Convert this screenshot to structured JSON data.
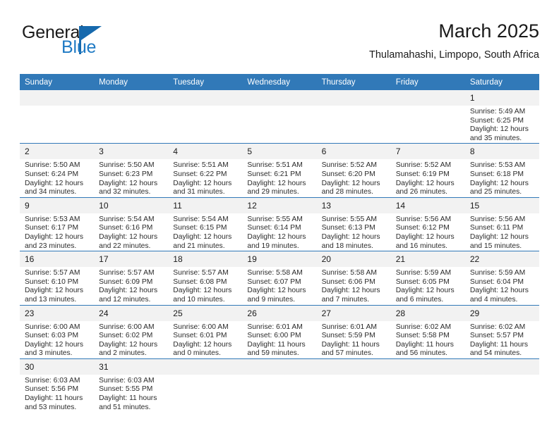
{
  "brand": {
    "name_top": "General",
    "name_bottom": "Blue",
    "accent_color": "#1f7ac4",
    "flag_color": "#1669ad"
  },
  "header": {
    "title": "March 2025",
    "subtitle": "Thulamahashi, Limpopo, South Africa",
    "header_bg_color": "#3179b8",
    "daynum_bg_color": "#f2f2f2"
  },
  "weekdays": [
    "Sunday",
    "Monday",
    "Tuesday",
    "Wednesday",
    "Thursday",
    "Friday",
    "Saturday"
  ],
  "weeks": [
    [
      {
        "day": "",
        "sunrise": "",
        "sunset": "",
        "daylight_1": "",
        "daylight_2": ""
      },
      {
        "day": "",
        "sunrise": "",
        "sunset": "",
        "daylight_1": "",
        "daylight_2": ""
      },
      {
        "day": "",
        "sunrise": "",
        "sunset": "",
        "daylight_1": "",
        "daylight_2": ""
      },
      {
        "day": "",
        "sunrise": "",
        "sunset": "",
        "daylight_1": "",
        "daylight_2": ""
      },
      {
        "day": "",
        "sunrise": "",
        "sunset": "",
        "daylight_1": "",
        "daylight_2": ""
      },
      {
        "day": "",
        "sunrise": "",
        "sunset": "",
        "daylight_1": "",
        "daylight_2": ""
      },
      {
        "day": "1",
        "sunrise": "Sunrise: 5:49 AM",
        "sunset": "Sunset: 6:25 PM",
        "daylight_1": "Daylight: 12 hours",
        "daylight_2": "and 35 minutes."
      }
    ],
    [
      {
        "day": "2",
        "sunrise": "Sunrise: 5:50 AM",
        "sunset": "Sunset: 6:24 PM",
        "daylight_1": "Daylight: 12 hours",
        "daylight_2": "and 34 minutes."
      },
      {
        "day": "3",
        "sunrise": "Sunrise: 5:50 AM",
        "sunset": "Sunset: 6:23 PM",
        "daylight_1": "Daylight: 12 hours",
        "daylight_2": "and 32 minutes."
      },
      {
        "day": "4",
        "sunrise": "Sunrise: 5:51 AM",
        "sunset": "Sunset: 6:22 PM",
        "daylight_1": "Daylight: 12 hours",
        "daylight_2": "and 31 minutes."
      },
      {
        "day": "5",
        "sunrise": "Sunrise: 5:51 AM",
        "sunset": "Sunset: 6:21 PM",
        "daylight_1": "Daylight: 12 hours",
        "daylight_2": "and 29 minutes."
      },
      {
        "day": "6",
        "sunrise": "Sunrise: 5:52 AM",
        "sunset": "Sunset: 6:20 PM",
        "daylight_1": "Daylight: 12 hours",
        "daylight_2": "and 28 minutes."
      },
      {
        "day": "7",
        "sunrise": "Sunrise: 5:52 AM",
        "sunset": "Sunset: 6:19 PM",
        "daylight_1": "Daylight: 12 hours",
        "daylight_2": "and 26 minutes."
      },
      {
        "day": "8",
        "sunrise": "Sunrise: 5:53 AM",
        "sunset": "Sunset: 6:18 PM",
        "daylight_1": "Daylight: 12 hours",
        "daylight_2": "and 25 minutes."
      }
    ],
    [
      {
        "day": "9",
        "sunrise": "Sunrise: 5:53 AM",
        "sunset": "Sunset: 6:17 PM",
        "daylight_1": "Daylight: 12 hours",
        "daylight_2": "and 23 minutes."
      },
      {
        "day": "10",
        "sunrise": "Sunrise: 5:54 AM",
        "sunset": "Sunset: 6:16 PM",
        "daylight_1": "Daylight: 12 hours",
        "daylight_2": "and 22 minutes."
      },
      {
        "day": "11",
        "sunrise": "Sunrise: 5:54 AM",
        "sunset": "Sunset: 6:15 PM",
        "daylight_1": "Daylight: 12 hours",
        "daylight_2": "and 21 minutes."
      },
      {
        "day": "12",
        "sunrise": "Sunrise: 5:55 AM",
        "sunset": "Sunset: 6:14 PM",
        "daylight_1": "Daylight: 12 hours",
        "daylight_2": "and 19 minutes."
      },
      {
        "day": "13",
        "sunrise": "Sunrise: 5:55 AM",
        "sunset": "Sunset: 6:13 PM",
        "daylight_1": "Daylight: 12 hours",
        "daylight_2": "and 18 minutes."
      },
      {
        "day": "14",
        "sunrise": "Sunrise: 5:56 AM",
        "sunset": "Sunset: 6:12 PM",
        "daylight_1": "Daylight: 12 hours",
        "daylight_2": "and 16 minutes."
      },
      {
        "day": "15",
        "sunrise": "Sunrise: 5:56 AM",
        "sunset": "Sunset: 6:11 PM",
        "daylight_1": "Daylight: 12 hours",
        "daylight_2": "and 15 minutes."
      }
    ],
    [
      {
        "day": "16",
        "sunrise": "Sunrise: 5:57 AM",
        "sunset": "Sunset: 6:10 PM",
        "daylight_1": "Daylight: 12 hours",
        "daylight_2": "and 13 minutes."
      },
      {
        "day": "17",
        "sunrise": "Sunrise: 5:57 AM",
        "sunset": "Sunset: 6:09 PM",
        "daylight_1": "Daylight: 12 hours",
        "daylight_2": "and 12 minutes."
      },
      {
        "day": "18",
        "sunrise": "Sunrise: 5:57 AM",
        "sunset": "Sunset: 6:08 PM",
        "daylight_1": "Daylight: 12 hours",
        "daylight_2": "and 10 minutes."
      },
      {
        "day": "19",
        "sunrise": "Sunrise: 5:58 AM",
        "sunset": "Sunset: 6:07 PM",
        "daylight_1": "Daylight: 12 hours",
        "daylight_2": "and 9 minutes."
      },
      {
        "day": "20",
        "sunrise": "Sunrise: 5:58 AM",
        "sunset": "Sunset: 6:06 PM",
        "daylight_1": "Daylight: 12 hours",
        "daylight_2": "and 7 minutes."
      },
      {
        "day": "21",
        "sunrise": "Sunrise: 5:59 AM",
        "sunset": "Sunset: 6:05 PM",
        "daylight_1": "Daylight: 12 hours",
        "daylight_2": "and 6 minutes."
      },
      {
        "day": "22",
        "sunrise": "Sunrise: 5:59 AM",
        "sunset": "Sunset: 6:04 PM",
        "daylight_1": "Daylight: 12 hours",
        "daylight_2": "and 4 minutes."
      }
    ],
    [
      {
        "day": "23",
        "sunrise": "Sunrise: 6:00 AM",
        "sunset": "Sunset: 6:03 PM",
        "daylight_1": "Daylight: 12 hours",
        "daylight_2": "and 3 minutes."
      },
      {
        "day": "24",
        "sunrise": "Sunrise: 6:00 AM",
        "sunset": "Sunset: 6:02 PM",
        "daylight_1": "Daylight: 12 hours",
        "daylight_2": "and 2 minutes."
      },
      {
        "day": "25",
        "sunrise": "Sunrise: 6:00 AM",
        "sunset": "Sunset: 6:01 PM",
        "daylight_1": "Daylight: 12 hours",
        "daylight_2": "and 0 minutes."
      },
      {
        "day": "26",
        "sunrise": "Sunrise: 6:01 AM",
        "sunset": "Sunset: 6:00 PM",
        "daylight_1": "Daylight: 11 hours",
        "daylight_2": "and 59 minutes."
      },
      {
        "day": "27",
        "sunrise": "Sunrise: 6:01 AM",
        "sunset": "Sunset: 5:59 PM",
        "daylight_1": "Daylight: 11 hours",
        "daylight_2": "and 57 minutes."
      },
      {
        "day": "28",
        "sunrise": "Sunrise: 6:02 AM",
        "sunset": "Sunset: 5:58 PM",
        "daylight_1": "Daylight: 11 hours",
        "daylight_2": "and 56 minutes."
      },
      {
        "day": "29",
        "sunrise": "Sunrise: 6:02 AM",
        "sunset": "Sunset: 5:57 PM",
        "daylight_1": "Daylight: 11 hours",
        "daylight_2": "and 54 minutes."
      }
    ],
    [
      {
        "day": "30",
        "sunrise": "Sunrise: 6:03 AM",
        "sunset": "Sunset: 5:56 PM",
        "daylight_1": "Daylight: 11 hours",
        "daylight_2": "and 53 minutes."
      },
      {
        "day": "31",
        "sunrise": "Sunrise: 6:03 AM",
        "sunset": "Sunset: 5:55 PM",
        "daylight_1": "Daylight: 11 hours",
        "daylight_2": "and 51 minutes."
      },
      {
        "day": "",
        "sunrise": "",
        "sunset": "",
        "daylight_1": "",
        "daylight_2": ""
      },
      {
        "day": "",
        "sunrise": "",
        "sunset": "",
        "daylight_1": "",
        "daylight_2": ""
      },
      {
        "day": "",
        "sunrise": "",
        "sunset": "",
        "daylight_1": "",
        "daylight_2": ""
      },
      {
        "day": "",
        "sunrise": "",
        "sunset": "",
        "daylight_1": "",
        "daylight_2": ""
      },
      {
        "day": "",
        "sunrise": "",
        "sunset": "",
        "daylight_1": "",
        "daylight_2": ""
      }
    ]
  ]
}
